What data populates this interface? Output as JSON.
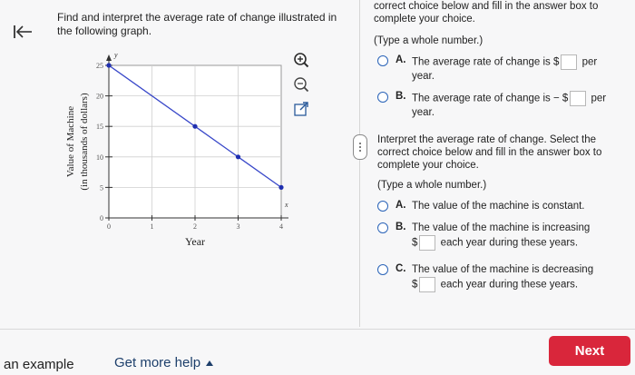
{
  "question": {
    "stem": "Find and interpret the average rate of change illustrated in the following graph."
  },
  "graph": {
    "y_axis_label_line1": "Value of Machine",
    "y_axis_label_line2": "(in thousands of dollars)",
    "x_axis_label": "Year",
    "y_axis_var": "y",
    "x_axis_var": "x",
    "x_ticks": [
      "0",
      "1",
      "2",
      "3",
      "4"
    ],
    "y_ticks": [
      "0",
      "5",
      "10",
      "15",
      "20",
      "25"
    ],
    "line_color": "#3948c9",
    "point_color": "#1f2fb0"
  },
  "chart_data": {
    "type": "line",
    "xlabel": "Year",
    "ylabel": "Value of Machine (in thousands of dollars)",
    "xlim": [
      0,
      4
    ],
    "ylim": [
      0,
      25
    ],
    "grid": true,
    "series": [
      {
        "x": [
          0,
          2,
          3,
          4
        ],
        "y": [
          25,
          15,
          10,
          5
        ]
      }
    ]
  },
  "tools": {
    "zoom_in": "zoom-in-icon",
    "zoom_out": "zoom-out-icon",
    "popout": "external-link-icon"
  },
  "part1": {
    "instruction": "correct choice below and fill in the answer box to complete your choice.",
    "hint": "(Type a whole number.)",
    "options": [
      {
        "letter": "A.",
        "before": "The average rate of change is $",
        "after": "per",
        "line2": "year."
      },
      {
        "letter": "B.",
        "before": "The average rate of change is − $",
        "after": "per",
        "line2": "year."
      }
    ]
  },
  "part2": {
    "instruction": "Interpret the average rate of change. Select the correct choice below and fill in the answer box to complete your choice.",
    "hint": "(Type a whole number.)",
    "options": [
      {
        "letter": "A.",
        "text": "The value of the machine is constant."
      },
      {
        "letter": "B.",
        "text": "The value of the machine is increasing",
        "line2_before": "$",
        "line2_after": "each year during these years."
      },
      {
        "letter": "C.",
        "text": "The value of the machine is decreasing",
        "line2_before": "$",
        "line2_after": "each year during these years."
      }
    ]
  },
  "footer": {
    "example_link": "an example",
    "help_link": "Get more help",
    "next_button": "Next",
    "next_color": "#d9263b"
  }
}
